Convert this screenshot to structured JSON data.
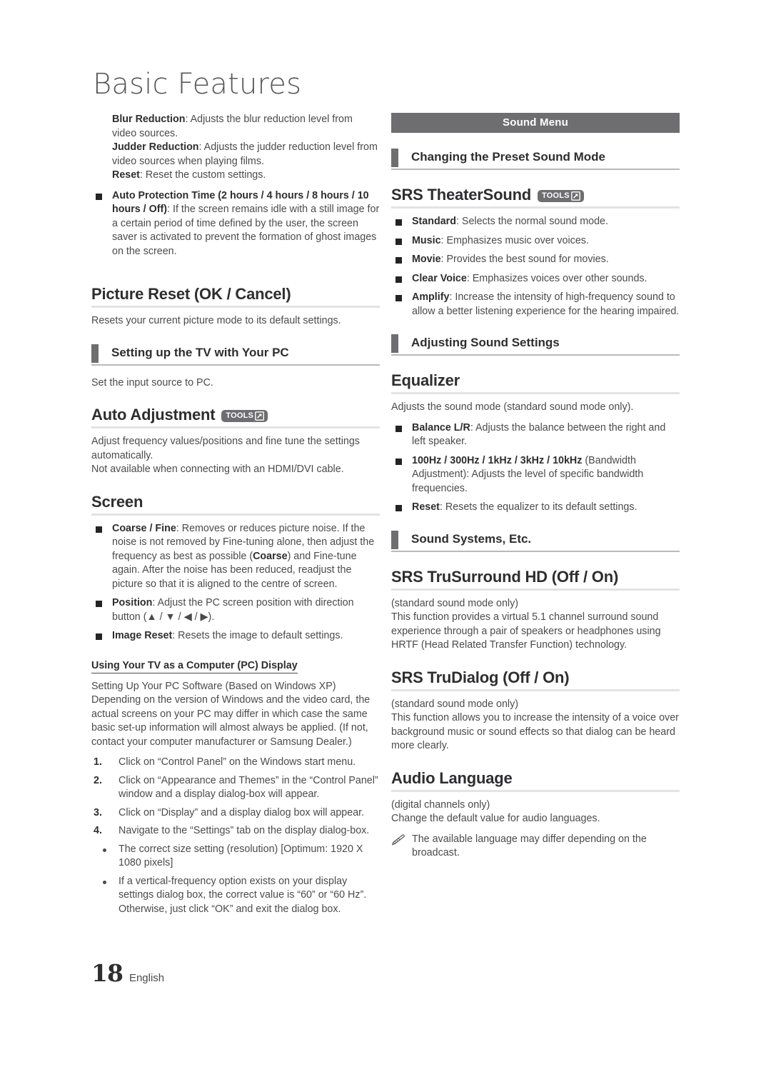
{
  "page": {
    "title": "Basic Features",
    "number": "18",
    "language": "English"
  },
  "badges": {
    "tools_label": "TOOLS",
    "tools_icon": "tools-arrow-icon"
  },
  "left_column": {
    "intro_paragraphs": [
      {
        "bold": "Blur Reduction",
        "text": ": Adjusts the blur reduction level from video sources."
      },
      {
        "bold": "Judder Reduction",
        "text": ": Adjusts the judder reduction level from video sources when playing films."
      },
      {
        "bold": "Reset",
        "text": ": Reset the custom settings."
      }
    ],
    "auto_protection_bullet": {
      "bold": "Auto Protection Time (2 hours / 4 hours / 8 hours / 10 hours / Off)",
      "text": ":  If the screen remains idle with a still image for a certain period of time defined by the user, the screen saver is activated to prevent the formation of ghost images on the screen."
    },
    "picture_reset": {
      "heading": "Picture Reset (OK / Cancel)",
      "body": "Resets your current picture mode to its default settings."
    },
    "setting_up_pc": {
      "subheading": "Setting up the TV with Your PC",
      "body": "Set the input source to PC."
    },
    "auto_adjustment": {
      "heading": "Auto Adjustment",
      "has_tools": true,
      "body_1": "Adjust frequency values/positions and fine tune the settings automatically.",
      "body_2": "Not available when connecting with an HDMI/DVI cable."
    },
    "screen": {
      "heading": "Screen",
      "bullets": [
        {
          "bold": "Coarse / Fine",
          "text": ": Removes or reduces picture noise. If the noise is not removed by Fine-tuning alone, then adjust the frequency as best as possible (",
          "bold2": "Coarse",
          "text2": ") and Fine-tune again. After the noise has been reduced, readjust the picture so that it is aligned to the centre of screen."
        },
        {
          "bold": "Position",
          "text": ": Adjust the PC screen position with direction button (▲ / ▼ / ◀ / ▶)."
        },
        {
          "bold": "Image Reset",
          "text": ": Resets the image to default settings."
        }
      ]
    },
    "pc_display": {
      "underlined_heading": "Using Your TV as a Computer (PC) Display",
      "line_1": "Setting Up Your PC Software (Based on Windows XP)",
      "line_2": "Depending on the version of Windows and the video card, the actual screens on your PC may differ in which case the same basic set-up information will almost always be applied. (If not, contact your computer manufacturer or Samsung Dealer.)",
      "steps": [
        {
          "num": "1.",
          "text": "Click on “Control Panel” on the Windows start menu."
        },
        {
          "num": "2.",
          "text": "Click on “Appearance and Themes” in the “Control Panel” window and a display dialog-box will appear."
        },
        {
          "num": "3.",
          "text": "Click on “Display” and a display dialog box will appear."
        },
        {
          "num": "4.",
          "text": "Navigate to the “Settings” tab on the display dialog-box."
        }
      ],
      "notes": [
        "The correct size setting (resolution) [Optimum: 1920 X 1080 pixels]",
        "If a vertical-frequency option exists on your display settings dialog box, the correct value is “60” or “60 Hz”. Otherwise, just click “OK” and exit the dialog box."
      ]
    }
  },
  "right_column": {
    "menu_banner": "Sound Menu",
    "preset_sound_mode": {
      "subheading": "Changing the Preset Sound Mode"
    },
    "srs_theatersound": {
      "heading": "SRS TheaterSound",
      "has_tools": true,
      "bullets": [
        {
          "bold": "Standard",
          "text": ": Selects the normal sound mode."
        },
        {
          "bold": "Music",
          "text": ": Emphasizes music over voices."
        },
        {
          "bold": "Movie",
          "text": ": Provides the best sound for movies."
        },
        {
          "bold": "Clear Voice",
          "text": ": Emphasizes voices over other sounds."
        },
        {
          "bold": "Amplify",
          "text": ": Increase the intensity of high-frequency sound to allow a better listening experience for the hearing impaired."
        }
      ]
    },
    "adjusting_sound_settings": {
      "subheading": "Adjusting Sound Settings"
    },
    "equalizer": {
      "heading": "Equalizer",
      "body": "Adjusts the sound mode (standard sound mode only).",
      "bullets": [
        {
          "bold": "Balance L/R",
          "text": ": Adjusts the balance between the right and left speaker."
        },
        {
          "bold": "100Hz / 300Hz / 1kHz / 3kHz / 10kHz",
          "text": " (Bandwidth Adjustment): Adjusts the level of specific bandwidth frequencies."
        },
        {
          "bold": "Reset",
          "text": ": Resets the equalizer to its default settings."
        }
      ]
    },
    "sound_systems": {
      "subheading": "Sound Systems, Etc."
    },
    "srs_trusurround": {
      "heading": "SRS TruSurround HD (Off / On)",
      "note": "(standard sound mode only)",
      "body": "This function provides a virtual 5.1 channel surround sound experience through a pair of speakers or headphones using HRTF (Head Related Transfer Function) technology."
    },
    "srs_trudialog": {
      "heading": "SRS TruDialog (Off / On)",
      "note": "(standard sound mode only)",
      "body": "This function allows you to increase the intensity of a voice over background music or sound effects so that dialog can be heard more clearly."
    },
    "audio_language": {
      "heading": "Audio Language",
      "note": "(digital channels only)",
      "body": "Change the default value for audio languages.",
      "pencil_note": "The available language may differ depending on the broadcast."
    }
  }
}
